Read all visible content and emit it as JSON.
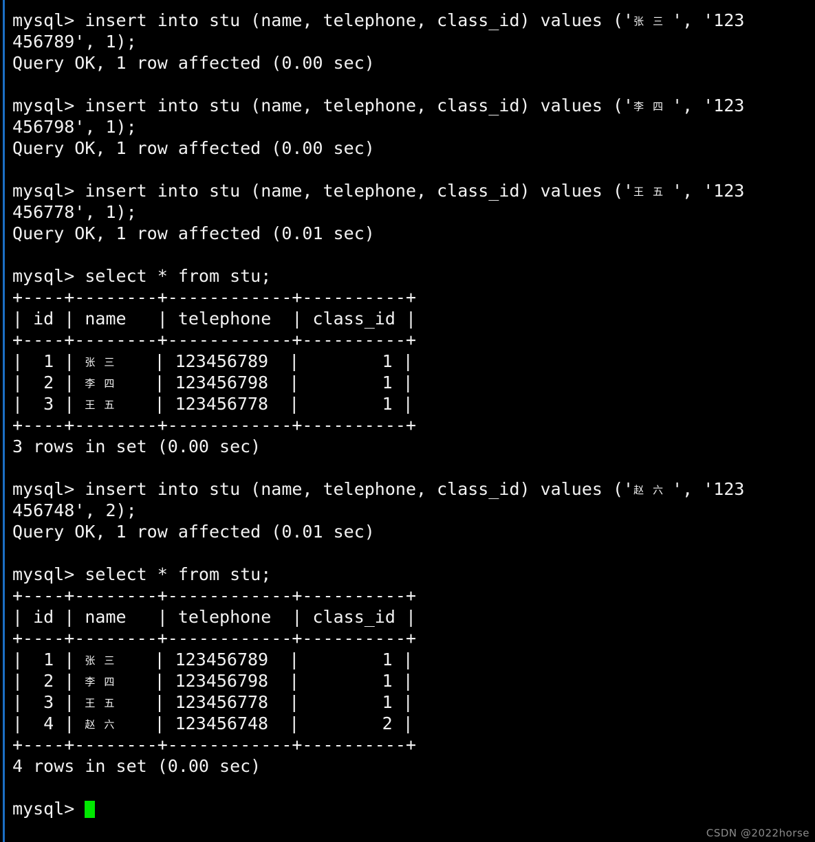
{
  "terminal": {
    "prompt": "mysql> ",
    "background_color": "#000000",
    "text_color": "#f2f2f2",
    "rail_color": "#1b6fc4",
    "cursor_color": "#00e800",
    "cursor_name": "block-cursor"
  },
  "watermark": {
    "text": "CSDN @2022horse",
    "color": "#8b8b8b"
  },
  "lines": [
    {
      "kind": "command",
      "text": "mysql> insert into stu (name, telephone, class_id) values ('",
      "cjk": "张三",
      "tail": "', '123"
    },
    {
      "kind": "command-wrap",
      "text": "456789', 1);"
    },
    {
      "kind": "output",
      "text": "Query OK, 1 row affected (0.00 sec)"
    },
    {
      "kind": "blank",
      "text": ""
    },
    {
      "kind": "command",
      "text": "mysql> insert into stu (name, telephone, class_id) values ('",
      "cjk": "李四",
      "tail": "', '123"
    },
    {
      "kind": "command-wrap",
      "text": "456798', 1);"
    },
    {
      "kind": "output",
      "text": "Query OK, 1 row affected (0.00 sec)"
    },
    {
      "kind": "blank",
      "text": ""
    },
    {
      "kind": "command",
      "text": "mysql> insert into stu (name, telephone, class_id) values ('",
      "cjk": "王五",
      "tail": "', '123"
    },
    {
      "kind": "command-wrap",
      "text": "456778', 1);"
    },
    {
      "kind": "output",
      "text": "Query OK, 1 row affected (0.01 sec)"
    },
    {
      "kind": "blank",
      "text": ""
    },
    {
      "kind": "command",
      "text": "mysql> select * from stu;"
    },
    {
      "kind": "output",
      "text": "+----+--------+------------+----------+"
    },
    {
      "kind": "output",
      "text": "| id | name   | telephone  | class_id |"
    },
    {
      "kind": "output",
      "text": "+----+--------+------------+----------+"
    },
    {
      "kind": "row",
      "pre": "|  1 | ",
      "cjk": "张三",
      "post": "   | 123456789  |        1 |"
    },
    {
      "kind": "row",
      "pre": "|  2 | ",
      "cjk": "李四",
      "post": "   | 123456798  |        1 |"
    },
    {
      "kind": "row",
      "pre": "|  3 | ",
      "cjk": "王五",
      "post": "   | 123456778  |        1 |"
    },
    {
      "kind": "output",
      "text": "+----+--------+------------+----------+"
    },
    {
      "kind": "output",
      "text": "3 rows in set (0.00 sec)"
    },
    {
      "kind": "blank",
      "text": ""
    },
    {
      "kind": "command",
      "text": "mysql> insert into stu (name, telephone, class_id) values ('",
      "cjk": "赵六",
      "tail": "', '123"
    },
    {
      "kind": "command-wrap",
      "text": "456748', 2);"
    },
    {
      "kind": "output",
      "text": "Query OK, 1 row affected (0.01 sec)"
    },
    {
      "kind": "blank",
      "text": ""
    },
    {
      "kind": "command",
      "text": "mysql> select * from stu;"
    },
    {
      "kind": "output",
      "text": "+----+--------+------------+----------+"
    },
    {
      "kind": "output",
      "text": "| id | name   | telephone  | class_id |"
    },
    {
      "kind": "output",
      "text": "+----+--------+------------+----------+"
    },
    {
      "kind": "row",
      "pre": "|  1 | ",
      "cjk": "张三",
      "post": "   | 123456789  |        1 |"
    },
    {
      "kind": "row",
      "pre": "|  2 | ",
      "cjk": "李四",
      "post": "   | 123456798  |        1 |"
    },
    {
      "kind": "row",
      "pre": "|  3 | ",
      "cjk": "王五",
      "post": "   | 123456778  |        1 |"
    },
    {
      "kind": "row",
      "pre": "|  4 | ",
      "cjk": "赵六",
      "post": "   | 123456748  |        2 |"
    },
    {
      "kind": "output",
      "text": "+----+--------+------------+----------+"
    },
    {
      "kind": "output",
      "text": "4 rows in set (0.00 sec)"
    },
    {
      "kind": "blank",
      "text": ""
    },
    {
      "kind": "prompt",
      "text": "mysql> "
    }
  ],
  "session": {
    "table_name": "stu",
    "columns": [
      "id",
      "name",
      "telephone",
      "class_id"
    ],
    "first_result": {
      "rows": [
        {
          "id": "1",
          "name": "张三",
          "telephone": "123456789",
          "class_id": "1"
        },
        {
          "id": "2",
          "name": "李四",
          "telephone": "123456798",
          "class_id": "1"
        },
        {
          "id": "3",
          "name": "王五",
          "telephone": "123456778",
          "class_id": "1"
        }
      ],
      "footer": "3 rows in set (0.00 sec)"
    },
    "second_result": {
      "rows": [
        {
          "id": "1",
          "name": "张三",
          "telephone": "123456789",
          "class_id": "1"
        },
        {
          "id": "2",
          "name": "李四",
          "telephone": "123456798",
          "class_id": "1"
        },
        {
          "id": "3",
          "name": "王五",
          "telephone": "123456778",
          "class_id": "1"
        },
        {
          "id": "4",
          "name": "赵六",
          "telephone": "123456748",
          "class_id": "2"
        }
      ],
      "footer": "4 rows in set (0.00 sec)"
    }
  }
}
